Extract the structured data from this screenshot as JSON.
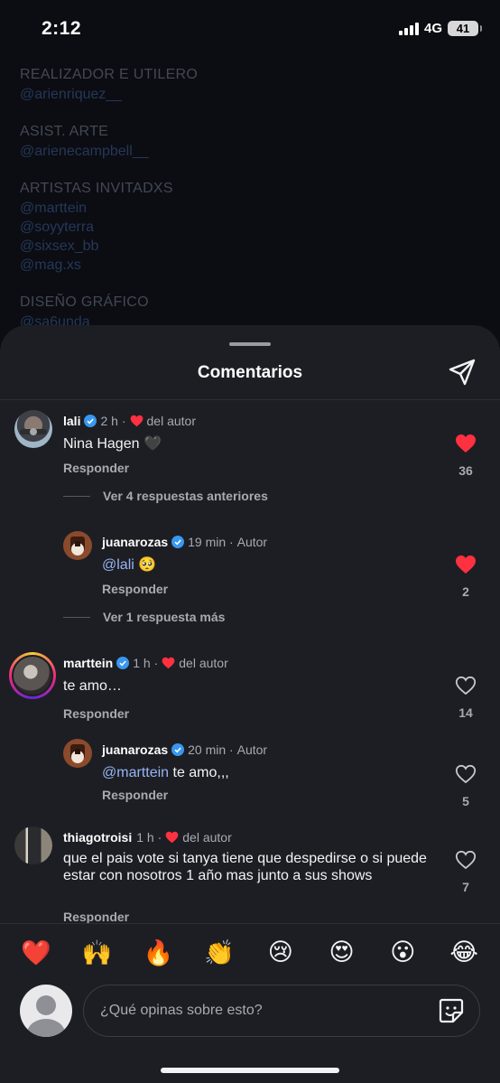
{
  "status_bar": {
    "time": "2:12",
    "network": "4G",
    "battery": "41"
  },
  "credits": [
    {
      "heading": "REALIZADOR E UTILERO",
      "handles": [
        "@arienriquez__"
      ]
    },
    {
      "heading": "ASIST. ARTE",
      "handles": [
        "@arienecampbell__"
      ]
    },
    {
      "heading": "ARTISTAS INVITADXS",
      "handles": [
        "@marttein",
        "@soyyterra",
        "@sixsex_bb",
        "@mag.xs"
      ]
    },
    {
      "heading": "DISEÑO GRÁFICO",
      "handles": [
        "@sa6unda"
      ]
    }
  ],
  "sheet": {
    "title": "Comentarios"
  },
  "comments": [
    {
      "user": "lali",
      "time": "2 h",
      "author_tag": "del autor",
      "text": "Nina Hagen 🖤",
      "reply_label": "Responder",
      "likes": "36",
      "liked": true
    },
    {
      "user": "juanarozas",
      "time": "19 min",
      "author_tag": "Autor",
      "mention": "@lali",
      "text": " 🥺",
      "reply_label": "Responder",
      "likes": "2",
      "liked": true
    },
    {
      "user": "marttein",
      "time": "1 h",
      "author_tag": "del autor",
      "text": "te amo…",
      "reply_label": "Responder",
      "likes": "14",
      "liked": false
    },
    {
      "user": "juanarozas",
      "time": "20 min",
      "author_tag": "Autor",
      "mention": "@marttein",
      "text": " te amo,,,",
      "reply_label": "Responder",
      "likes": "5",
      "liked": false
    },
    {
      "user": "thiagotroisi",
      "time": "1 h",
      "author_tag": "del autor",
      "text": "que el pais vote si tanya tiene que despedirse o si puede estar con nosotros 1 año mas junto a sus shows",
      "reply_label": "Responder",
      "likes": "7",
      "liked": false
    }
  ],
  "threads": {
    "lali_previous": "Ver 4 respuestas anteriores",
    "lali_more": "Ver 1 respuesta más"
  },
  "quick_reactions": [
    "❤️",
    "🙌",
    "🔥",
    "👏",
    "😢",
    "😍",
    "😮",
    "😂"
  ],
  "composer": {
    "placeholder": "¿Qué opinas sobre esto?"
  },
  "colors": {
    "like_red": "#ff3040",
    "verified_blue": "#3897f0",
    "mention": "#98b3f5"
  }
}
